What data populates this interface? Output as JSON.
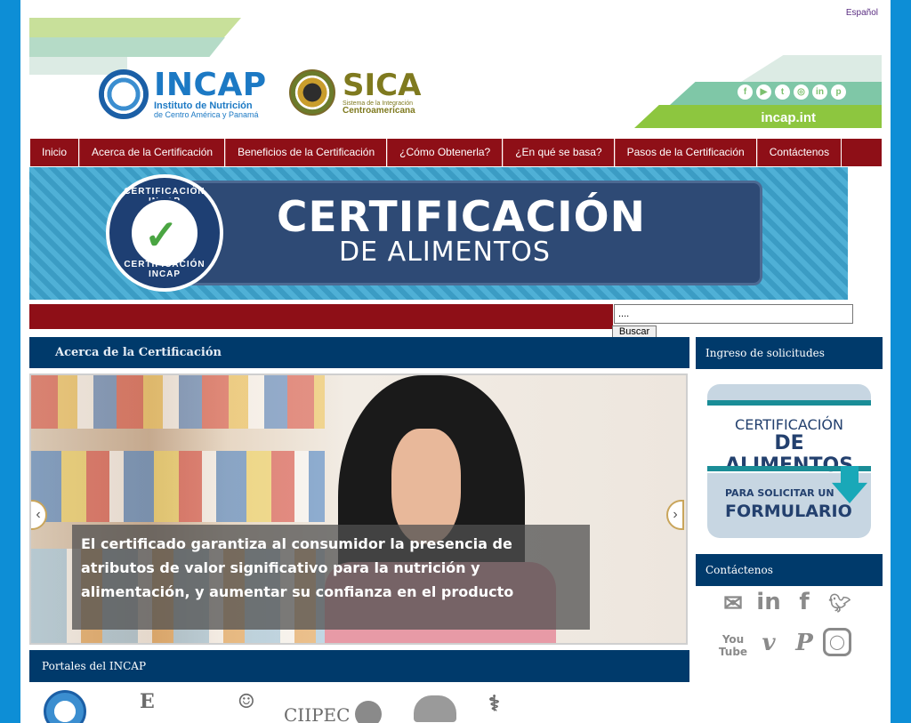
{
  "language_link": "Español",
  "header": {
    "incap": {
      "name": "INCAP",
      "subtitle1": "Instituto de Nutrición",
      "subtitle2": "de Centro América y Panamá"
    },
    "sica": {
      "name": "SICA",
      "subtitle1": "Sistema de la Integración",
      "subtitle2": "Centroamericana"
    },
    "social_icons": [
      "facebook-icon",
      "youtube-icon",
      "twitter-icon",
      "instagram-icon",
      "linkedin-icon",
      "pinterest-icon"
    ],
    "site": "incap.int"
  },
  "nav": {
    "items": [
      "Inicio",
      "Acerca de la Certificación",
      "Beneficios de la Certificación",
      "¿Cómo Obtenerla?",
      "¿En qué se basa?",
      "Pasos de la Certificación",
      "Contáctenos"
    ]
  },
  "banner": {
    "title1": "CERTIFICACIÓN",
    "title2": "DE ALIMENTOS",
    "badge_top": "CERTIFICACIÓN INCAP",
    "badge_bottom": "CERTIFICACIÓN INCAP"
  },
  "search": {
    "value": "....",
    "button": "Buscar"
  },
  "main": {
    "heading": "Acerca de la Certificación",
    "slide_caption": "El certificado garantiza al consumidor la presencia de atributos de valor significativo para la nutrición y alimentación, y aumentar su confianza en el producto"
  },
  "portals": {
    "heading": "Portales del INCAP",
    "logos": [
      "incap-seal",
      "E",
      "portrait",
      "CIIPEC",
      "globe",
      "hands",
      "stethoscope"
    ],
    "ciipec_text": "CIIPEC"
  },
  "sidebar": {
    "requests_heading": "Ingreso de solicitudes",
    "form_banner": {
      "line1": "CERTIFICACIÓN",
      "line2": "DE ALIMENTOS",
      "line3": "PARA SOLICITAR UN",
      "line4": "FORMULARIO"
    },
    "contact_heading": "Contáctenos",
    "contact_icons": [
      "mail-icon",
      "linkedin-icon",
      "facebook-icon",
      "twitter-icon",
      "youtube-icon",
      "vimeo-icon",
      "pinterest-icon",
      "instagram-icon"
    ]
  },
  "colors": {
    "nav_red": "#8e0f17",
    "navy": "#003a6b",
    "page_blue": "#0d8ed6",
    "green": "#8dc63f"
  }
}
